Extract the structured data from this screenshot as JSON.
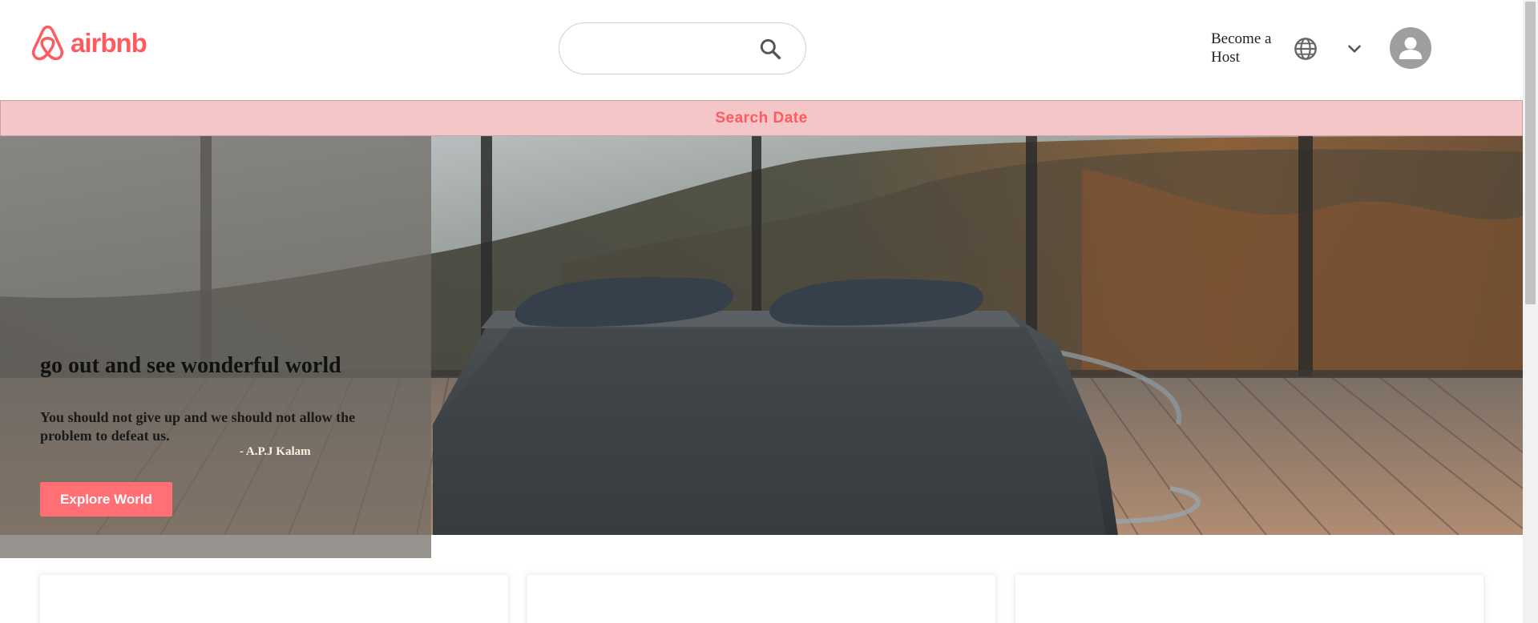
{
  "header": {
    "logo_text": "airbnb",
    "search_input_value": "",
    "search_placeholder": "",
    "become_host_label": "Become a Host",
    "icons": {
      "logo": "airbnb-belo-icon",
      "search": "search-icon",
      "language": "globe-icon",
      "dropdown": "chevron-down-icon",
      "profile": "user-avatar-icon"
    }
  },
  "date_bar": {
    "label": "Search Date"
  },
  "hero": {
    "title": "go out and see wonderful world",
    "quote": "You should not give up and we should not allow the problem to defeat us.",
    "author": "- A.P.J Kalam",
    "button_label": "Explore World"
  },
  "colors": {
    "brand": "#ff5a5f",
    "date_bar_bg": "#f4c6c7",
    "button_bg": "#ff6f73",
    "avatar_bg": "#9e9e9e"
  }
}
